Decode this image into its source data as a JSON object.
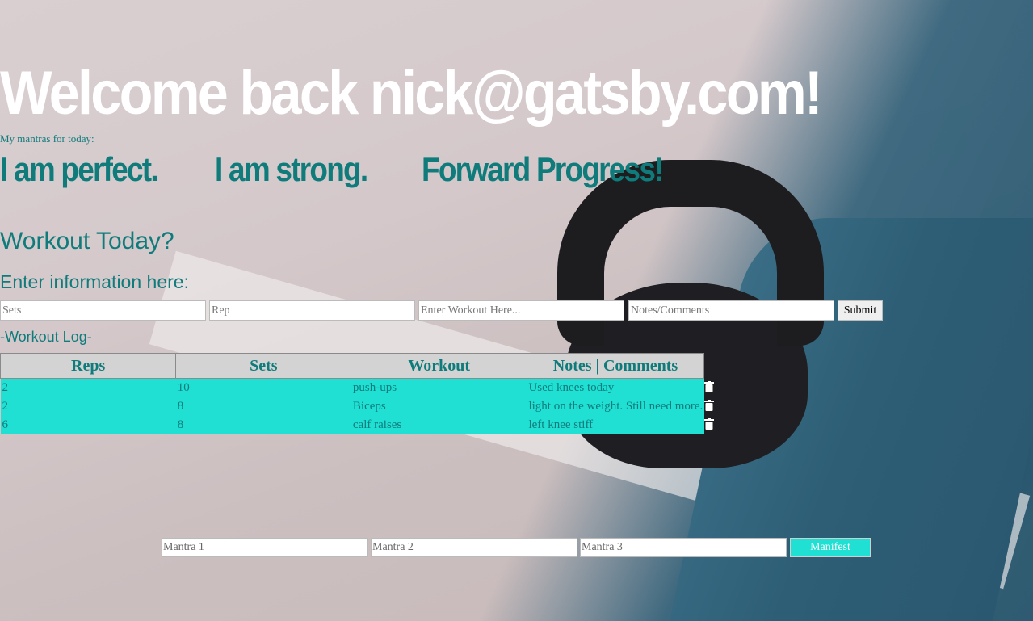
{
  "header": {
    "welcome": "Welcome back nick@gatsby.com!",
    "mantras_caption": "My mantras for today:",
    "mantras": [
      "I am perfect.",
      "I am strong.",
      "Forward Progress!"
    ]
  },
  "workout_form": {
    "title": "Workout Today?",
    "subtitle": "Enter information here:",
    "sets_placeholder": "Sets",
    "rep_placeholder": "Rep",
    "workout_placeholder": "Enter Workout Here...",
    "notes_placeholder": "Notes/Comments",
    "submit_label": "Submit"
  },
  "log": {
    "title": "-Workout Log-",
    "columns": [
      "Reps",
      "Sets",
      "Workout",
      "Notes | Comments"
    ],
    "rows": [
      {
        "reps": "2",
        "sets": "10",
        "workout": "push-ups",
        "notes": "Used knees today"
      },
      {
        "reps": "2",
        "sets": "8",
        "workout": "Biceps",
        "notes": "light on the weight. Still need more."
      },
      {
        "reps": "6",
        "sets": "8",
        "workout": "calf raises",
        "notes": "left knee stiff"
      }
    ],
    "row_action_icon": "trash-icon"
  },
  "mantra_form": {
    "mantra1_placeholder": "Mantra 1",
    "mantra2_placeholder": "Mantra 2",
    "mantra3_placeholder": "Mantra 3",
    "manifest_label": "Manifest"
  },
  "colors": {
    "accent_teal": "#0f7b7b",
    "row_background": "#20e0d4",
    "header_background": "#d3d3d3"
  }
}
